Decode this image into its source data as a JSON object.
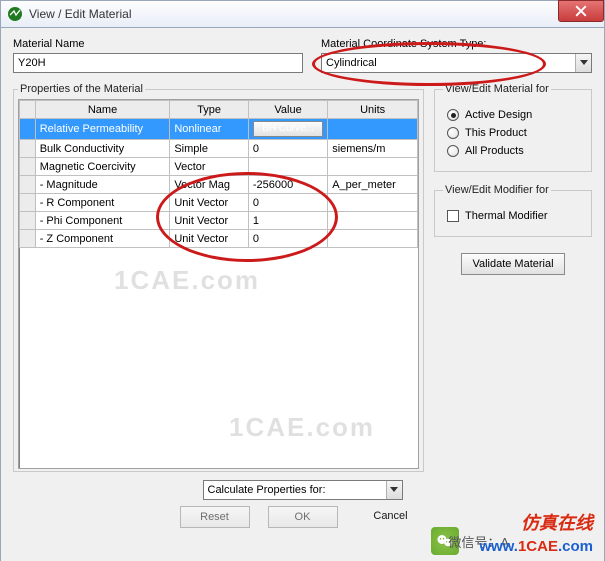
{
  "window": {
    "title": "View / Edit Material"
  },
  "labels": {
    "material_name": "Material Name",
    "coord_type": "Material Coordinate System Type:"
  },
  "fields": {
    "material_name_value": "Y20H",
    "coord_type_value": "Cylindrical"
  },
  "groups": {
    "properties": "Properties of the Material",
    "view_for": "View/Edit Material for",
    "modifier_for": "View/Edit Modifier for"
  },
  "table": {
    "headers": {
      "name": "Name",
      "type": "Type",
      "value": "Value",
      "units": "Units"
    },
    "rows": [
      {
        "name": "Relative Permeability",
        "type": "Nonlinear",
        "value_button": "BH Curve...",
        "units": "",
        "selected": true
      },
      {
        "name": "Bulk Conductivity",
        "type": "Simple",
        "value": "0",
        "units": "siemens/m"
      },
      {
        "name": "Magnetic Coercivity",
        "type": "Vector",
        "value": "",
        "units": ""
      },
      {
        "name": "- Magnitude",
        "type": "Vector Mag",
        "value": "-256000",
        "units": "A_per_meter"
      },
      {
        "name": "- R Component",
        "type": "Unit Vector",
        "value": "0",
        "units": ""
      },
      {
        "name": "- Phi Component",
        "type": "Unit Vector",
        "value": "1",
        "units": ""
      },
      {
        "name": "- Z Component",
        "type": "Unit Vector",
        "value": "0",
        "units": ""
      }
    ]
  },
  "radios": {
    "active_design": "Active Design",
    "this_product": "This Product",
    "all_products": "All Products"
  },
  "checks": {
    "thermal": "Thermal Modifier"
  },
  "buttons": {
    "validate": "Validate Material",
    "calculate": "Calculate Properties for:",
    "reset": "Reset",
    "ok": "OK",
    "cancel": "Cancel"
  },
  "watermarks": {
    "w1": "1CAE.com",
    "w2": "1CAE.com"
  },
  "footer": {
    "wx": "微信号：A",
    "brand1": "仿真在线",
    "brand2a": "www.",
    "brand2b": "1CAE",
    "brand2c": ".com"
  }
}
